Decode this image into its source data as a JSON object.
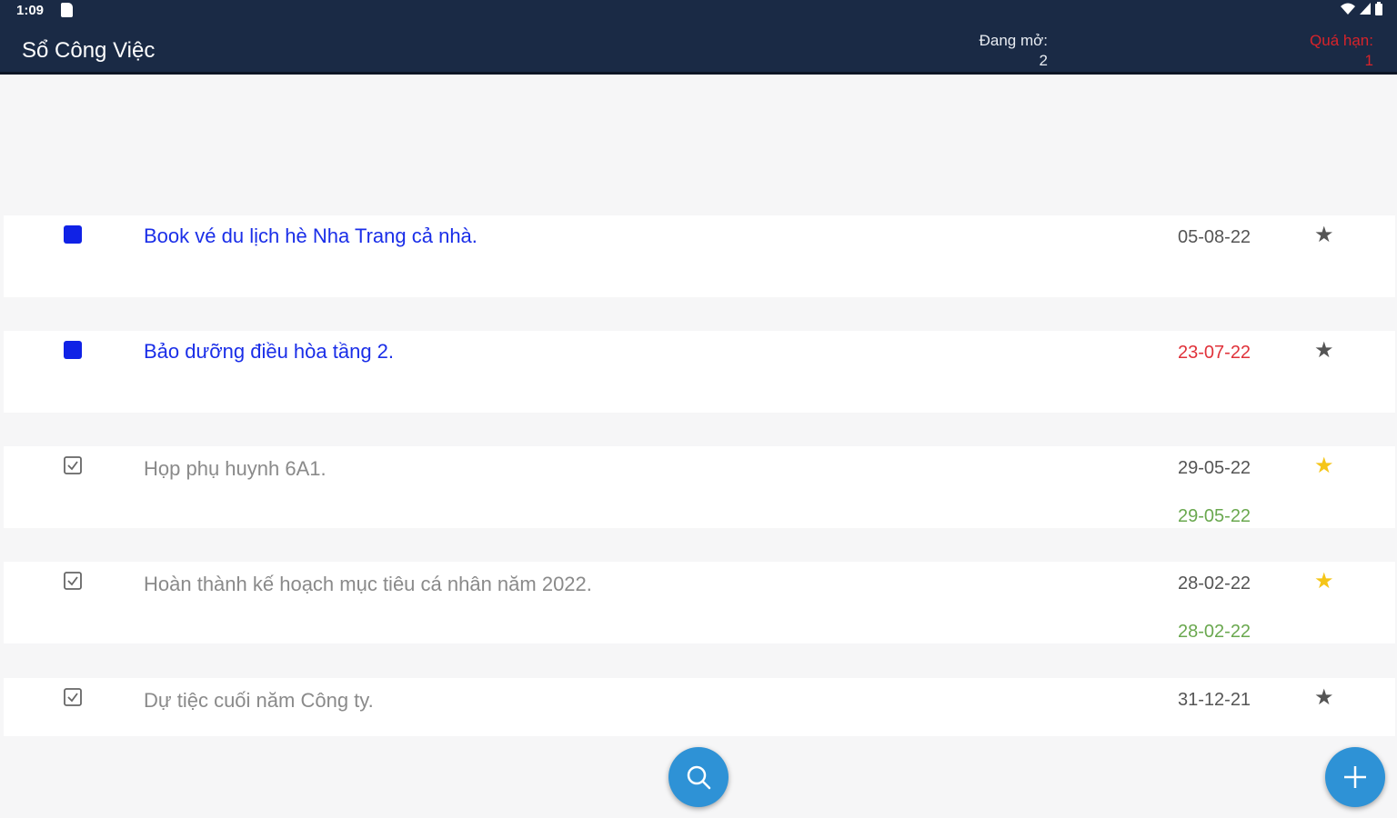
{
  "status_bar": {
    "time": "1:09"
  },
  "app_bar": {
    "title": "Sổ Công Việc",
    "open_label": "Đang mở:",
    "open_count": "2",
    "overdue_label": "Quá hạn:",
    "overdue_count": "1"
  },
  "tasks": [
    {
      "title": "Book vé du lịch hè Nha Trang cả nhà.",
      "date": "05-08-22",
      "status": "open",
      "starred": false
    },
    {
      "title": "Bảo dưỡng điều hòa tầng 2.",
      "date": "23-07-22",
      "status": "open-overdue",
      "starred": false
    },
    {
      "title": "Họp phụ huynh 6A1.",
      "date": "29-05-22",
      "completed_date": "29-05-22",
      "status": "done",
      "starred": true
    },
    {
      "title": "Hoàn thành kế hoạch mục tiêu cá nhân năm 2022.",
      "date": "28-02-22",
      "completed_date": "28-02-22",
      "status": "done",
      "starred": true
    },
    {
      "title": "Dự tiệc cuối năm Công ty.",
      "date": "31-12-21",
      "status": "done",
      "starred": false
    }
  ],
  "colors": {
    "app_bar": "#1a2a45",
    "open_task": "#1a2ee8",
    "overdue": "#e0323a",
    "completed_date": "#6aa84f",
    "star_active": "#f5c518",
    "fab": "#2e92d6"
  },
  "icons": {
    "search_fab": "search-icon",
    "add_fab": "plus-icon",
    "star": "star-icon",
    "checkbox": "checkbox-checked-icon"
  }
}
